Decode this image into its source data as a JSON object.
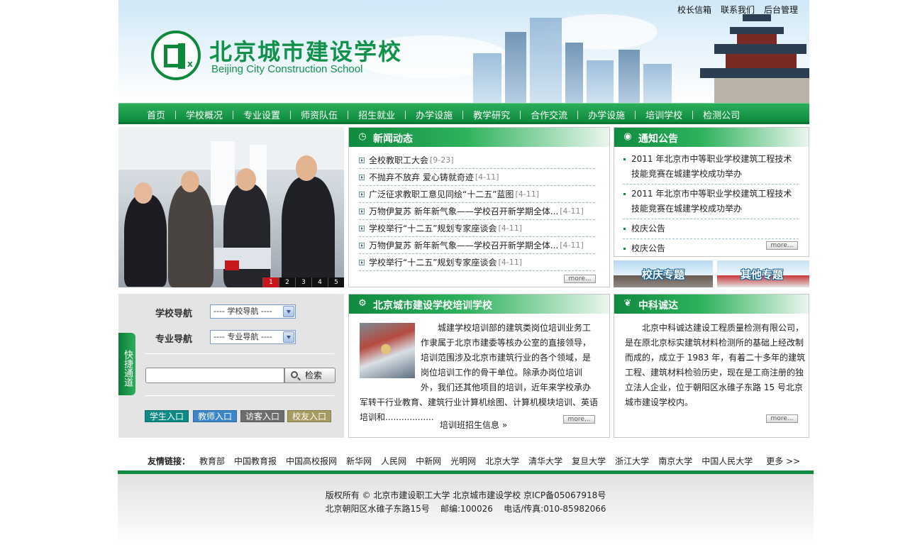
{
  "header": {
    "school_cn": "北京城市建设学校",
    "school_en": "Beijing City Construction School",
    "logo_letters": "BJ",
    "logo_x": "x",
    "top_links": [
      "校长信箱",
      "联系我们",
      "后台管理"
    ]
  },
  "nav": [
    "首页",
    "学校概况",
    "专业设置",
    "师资队伍",
    "招生就业",
    "办学设施",
    "教学研究",
    "合作交流",
    "办学设施",
    "培训学校",
    "检测公司"
  ],
  "slideshow": {
    "pages": [
      "1",
      "2",
      "3",
      "4",
      "5"
    ],
    "active": "1"
  },
  "news": {
    "title": "新闻动态",
    "items": [
      {
        "text": "全校教职工大会",
        "date": "[9-23]"
      },
      {
        "text": "不抛弃不放弃 爱心铸就奇迹",
        "date": "[4-11]"
      },
      {
        "text": "广泛征求教职工意见同绘“十二五”蓝图",
        "date": "[4-11]"
      },
      {
        "text": "万物伊复苏 新年新气象——学校召开新学期全体...",
        "date": "[4-11]"
      },
      {
        "text": "学校举行“十二五”规划专家座谈会",
        "date": "[4-11]"
      },
      {
        "text": "万物伊复苏 新年新气象——学校召开新学期全体...",
        "date": "[4-11]"
      },
      {
        "text": "学校举行“十二五”规划专家座谈会",
        "date": "[4-11]"
      }
    ],
    "more": "more..."
  },
  "notice": {
    "title": "通知公告",
    "items": [
      "2011 年北京市中等职业学校建筑工程技术技能竞赛在城建学校成功举办",
      "2011 年北京市中等职业学校建筑工程技术技能竞赛在城建学校成功举办",
      "校庆公告",
      "校庆公告"
    ],
    "more": "more..."
  },
  "banners": [
    "校庆专题",
    "其他专题"
  ],
  "quick": {
    "tab": "快捷通道",
    "school_nav_label": "学校导航",
    "school_nav_value": "---- 学校导航 ----",
    "major_nav_label": "专业导航",
    "major_nav_value": "---- 专业导航 ----",
    "search_button": "检索",
    "entries": [
      {
        "label": "学生入口",
        "color": "#0e8a86"
      },
      {
        "label": "教师入口",
        "color": "#3a86c8"
      },
      {
        "label": "访客入口",
        "color": "#6d6d6d"
      },
      {
        "label": "校友入口",
        "color": "#a79b61"
      }
    ]
  },
  "training": {
    "title": "北京城市建设学校培训学校",
    "body": "城建学校培训部的建筑类岗位培训业务工作隶属于北京市建委等核办公室的直接领导，培训范围涉及北京市建筑行业的各个领域，是岗位培训工作的骨干单位。除承办岗位培训外，我们还其他项目的培训，近年来学校承办军转干行业教育、建筑行业计算机绘图、计算机模块培训、英语培训和..................",
    "link": "培训班招生信息",
    "more": "more..."
  },
  "zhongke": {
    "title": "中科诚达",
    "body": "北京中科诚达建设工程质量检测有限公司，是在原北京标实建筑材料检测所的基础上经改制而成的，成立于 1983 年，有着二十多年的建筑工程、建筑材料检验历史，现在是工商注册的独立法人企业，位于朝阳区水碓子东路 15 号北京城市建设学校内。",
    "more": "more..."
  },
  "friends": {
    "label": "友情链接：",
    "links": [
      "教育部",
      "中国教育报",
      "中国高校报网",
      "新华网",
      "人民网",
      "中新网",
      "光明网",
      "北京大学",
      "清华大学",
      "复旦大学",
      "浙江大学",
      "南京大学",
      "中国人民大学"
    ],
    "more": "更多 >>"
  },
  "footer": {
    "line1": "版权所有 © 北京市建设职工大学 北京城市建设学校 京ICP备05067918号",
    "line2": "北京朝阳区水碓子东路15号    邮编:100026    电话/传真:010-85982066"
  }
}
